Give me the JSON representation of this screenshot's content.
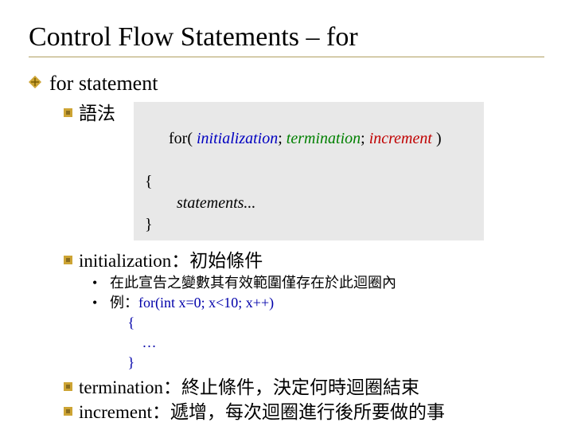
{
  "title": "Control Flow Statements – for",
  "l1": {
    "text": "for statement"
  },
  "l2": {
    "syntax_label": "語法",
    "init_label": "initialization：初始條件",
    "term_label": "termination：終止條件，決定何時迴圈結束",
    "inc_label": "increment：遞增，每次迴圈進行後所要做的事"
  },
  "code": {
    "for_kw": "for( ",
    "init": "initialization",
    "sep1": "; ",
    "term": "termination",
    "sep2": "; ",
    "inc": "increment",
    "close_paren": " )",
    "open_brace": "{",
    "body": "        statements...",
    "close_brace": "}"
  },
  "l3": {
    "b1": "•",
    "t1": "在此宣告之變數其有效範圍僅存在於此迴圈內",
    "b2": "•",
    "t2_prefix": "例：",
    "t2_code": "for(int x=0;  x<10;  x++)",
    "t2_line2": "     {",
    "t2_line3": "         …",
    "t2_line4": "     }"
  }
}
